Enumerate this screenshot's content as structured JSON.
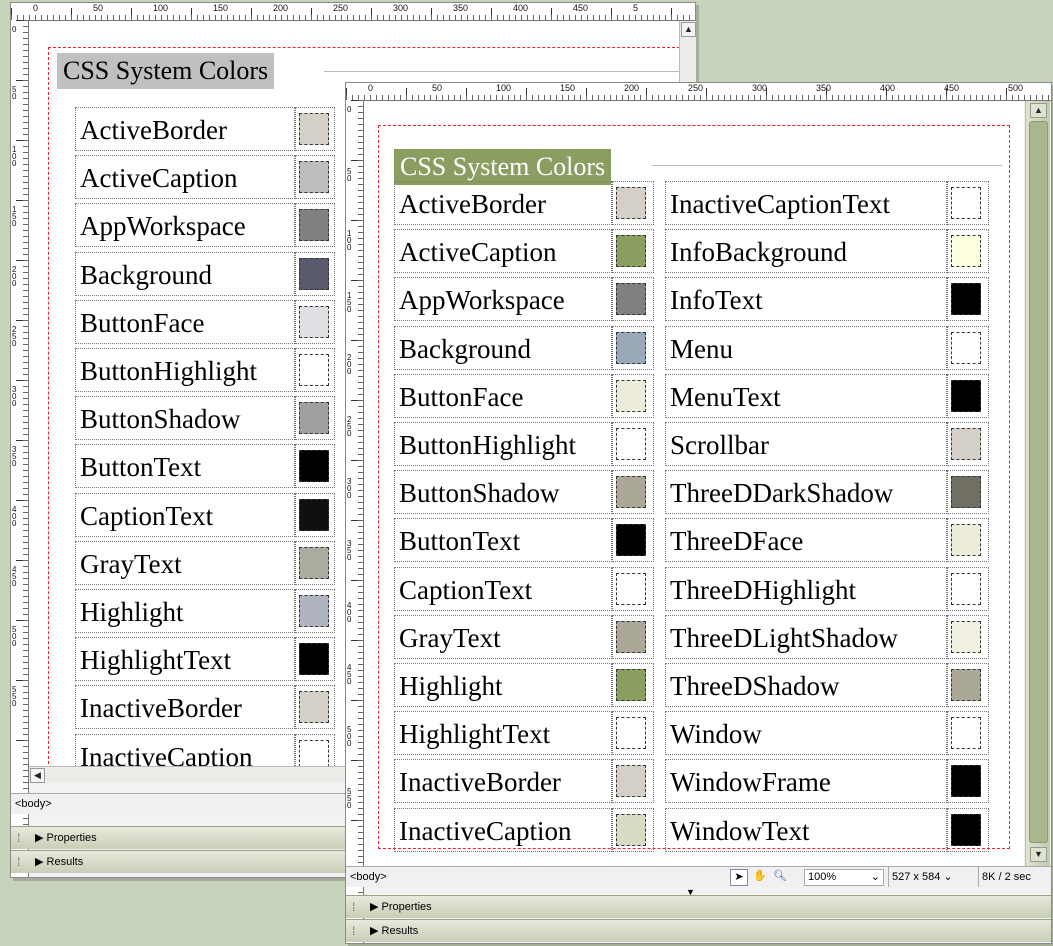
{
  "back_window": {
    "ruler_top": [
      "0",
      "50",
      "100",
      "150",
      "200",
      "250",
      "300",
      "350",
      "400",
      "450",
      "5"
    ],
    "ruler_left": [
      "0",
      "50",
      "100",
      "150",
      "200",
      "250",
      "300",
      "350",
      "400",
      "450",
      "500",
      "550"
    ],
    "page": {
      "heading": "CSS System Colors",
      "colors": [
        {
          "name": "ActiveBorder",
          "swatch": "#d4d0c8"
        },
        {
          "name": "ActiveCaption",
          "swatch": "#bdbdbd"
        },
        {
          "name": "AppWorkspace",
          "swatch": "#808080"
        },
        {
          "name": "Background",
          "swatch": "#5a5a6e"
        },
        {
          "name": "ButtonFace",
          "swatch": "#e0e0e4"
        },
        {
          "name": "ButtonHighlight",
          "swatch": "#ffffff"
        },
        {
          "name": "ButtonShadow",
          "swatch": "#a0a0a0"
        },
        {
          "name": "ButtonText",
          "swatch": "#000000"
        },
        {
          "name": "CaptionText",
          "swatch": "#101010"
        },
        {
          "name": "GrayText",
          "swatch": "#ababa0"
        },
        {
          "name": "Highlight",
          "swatch": "#b0b4c0"
        },
        {
          "name": "HighlightText",
          "swatch": "#000000"
        },
        {
          "name": "InactiveBorder",
          "swatch": "#d4d0c8"
        },
        {
          "name": "InactiveCaption",
          "swatch": "#ffffff"
        }
      ]
    },
    "tag_selector": "<body>",
    "panels": [
      "Properties",
      "Results"
    ]
  },
  "front_window": {
    "ruler_top": [
      "0",
      "50",
      "100",
      "150",
      "200",
      "250",
      "300",
      "350",
      "400",
      "450",
      "500"
    ],
    "ruler_left": [
      "0",
      "50",
      "100",
      "150",
      "200",
      "250",
      "300",
      "350",
      "400",
      "450",
      "500",
      "550"
    ],
    "page": {
      "heading": "CSS System Colors",
      "left_column": [
        {
          "name": "ActiveBorder",
          "swatch": "#d4d0c8"
        },
        {
          "name": "ActiveCaption",
          "swatch": "#8a9e62"
        },
        {
          "name": "AppWorkspace",
          "swatch": "#808080"
        },
        {
          "name": "Background",
          "swatch": "#9aa8b8"
        },
        {
          "name": "ButtonFace",
          "swatch": "#ecebdc"
        },
        {
          "name": "ButtonHighlight",
          "swatch": "#ffffff"
        },
        {
          "name": "ButtonShadow",
          "swatch": "#aca899"
        },
        {
          "name": "ButtonText",
          "swatch": "#000000"
        },
        {
          "name": "CaptionText",
          "swatch": "#ffffff"
        },
        {
          "name": "GrayText",
          "swatch": "#aca899"
        },
        {
          "name": "Highlight",
          "swatch": "#8a9e62"
        },
        {
          "name": "HighlightText",
          "swatch": "#ffffff"
        },
        {
          "name": "InactiveBorder",
          "swatch": "#d4d0c8"
        },
        {
          "name": "InactiveCaption",
          "swatch": "#d8dcc4"
        }
      ],
      "right_column": [
        {
          "name": "InactiveCaptionText",
          "swatch": "#ffffff"
        },
        {
          "name": "InfoBackground",
          "swatch": "#ffffe1"
        },
        {
          "name": "InfoText",
          "swatch": "#000000"
        },
        {
          "name": "Menu",
          "swatch": "#ffffff"
        },
        {
          "name": "MenuText",
          "swatch": "#000000"
        },
        {
          "name": "Scrollbar",
          "swatch": "#d4d0c8"
        },
        {
          "name": "ThreeDDarkShadow",
          "swatch": "#716f64"
        },
        {
          "name": "ThreeDFace",
          "swatch": "#ecebdc"
        },
        {
          "name": "ThreeDHighlight",
          "swatch": "#ffffff"
        },
        {
          "name": "ThreeDLightShadow",
          "swatch": "#f1efe2"
        },
        {
          "name": "ThreeDShadow",
          "swatch": "#aca899"
        },
        {
          "name": "Window",
          "swatch": "#ffffff"
        },
        {
          "name": "WindowFrame",
          "swatch": "#000000"
        },
        {
          "name": "WindowText",
          "swatch": "#000000"
        }
      ]
    },
    "status_bar": {
      "tag_selector": "<body>",
      "zoom": "100%",
      "window_size": "527 x 584",
      "download_stats": "8K / 2 sec"
    },
    "panels": [
      "Properties",
      "Results"
    ]
  },
  "icons": {
    "scroll_up": "scroll-up-arrow",
    "scroll_down": "scroll-down-arrow",
    "scroll_left": "scroll-left-arrow",
    "pointer": "pointer-tool",
    "hand": "hand-tool",
    "zoom": "zoom-tool",
    "expand": "triangle-right"
  },
  "theme": {
    "page_bg": "#c7d3bb",
    "front_heading_bg": "#8a9e62",
    "back_heading_bg": "#c0c0c0",
    "frame_dash": "#ee2233"
  }
}
